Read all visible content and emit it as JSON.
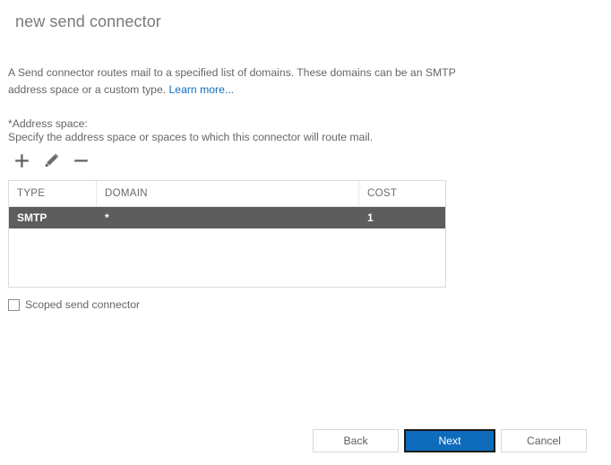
{
  "page": {
    "title": "new send connector"
  },
  "intro": {
    "text_before_link": "A Send connector routes mail to a specified list of domains. These domains can be an SMTP address space or a custom type. ",
    "link_label": "Learn more..."
  },
  "address_space": {
    "label": "*Address space:",
    "help": "Specify the address space or spaces to which this connector will route mail."
  },
  "toolbar": {
    "add": {
      "name": "add-icon",
      "title": "Add"
    },
    "edit": {
      "name": "edit-icon",
      "title": "Edit"
    },
    "remove": {
      "name": "remove-icon",
      "title": "Remove"
    }
  },
  "table": {
    "columns": [
      "TYPE",
      "DOMAIN",
      "COST"
    ],
    "rows": [
      {
        "type": "SMTP",
        "domain": "*",
        "cost": "1",
        "selected": true
      }
    ]
  },
  "scoped": {
    "label": "Scoped send connector",
    "checked": false
  },
  "footer": {
    "back_label": "Back",
    "next_label": "Next",
    "cancel_label": "Cancel"
  },
  "colors": {
    "accent_blue": "#0f6cbd",
    "selected_row": "#5d5d5d",
    "text_gray": "#666666",
    "title_gray": "#7a7a7a",
    "border_gray": "#d6dde2"
  }
}
